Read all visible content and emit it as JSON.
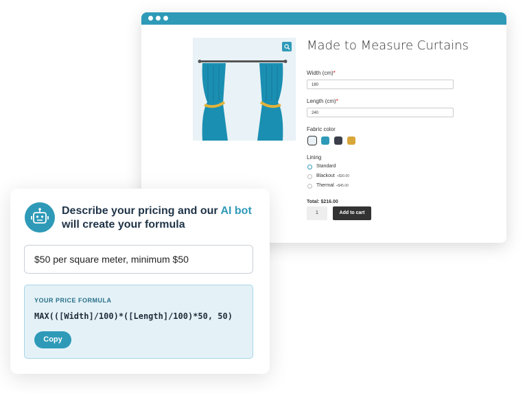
{
  "product": {
    "title": "Made to Measure Curtains",
    "width_label": "Width (cm)",
    "width_value": "180",
    "length_label": "Length (cm)",
    "length_value": "240",
    "required_mark": "*",
    "fabric_label": "Fabric color",
    "fabric_colors": [
      "#e9f2f6",
      "#2e9ab8",
      "#3a3f4a",
      "#d9a63a"
    ],
    "lining_label": "Lining",
    "lining_options": [
      {
        "label": "Standard",
        "price": "",
        "selected": true
      },
      {
        "label": "Blackout",
        "price": "+$30.00",
        "selected": false
      },
      {
        "label": "Thermal",
        "price": "+$45.00",
        "selected": false
      }
    ],
    "total": "Total: $216.00",
    "quantity": "1",
    "add_to_cart": "Add to cart"
  },
  "ai": {
    "headline_a": "Describe your pricing and our ",
    "headline_highlight": "AI bot",
    "headline_b": " will create your formula",
    "prompt": "$50 per square meter, minimum $50",
    "formula_label": "YOUR PRICE FORMULA",
    "formula": "MAX(([Width]/100)*([Length]/100)*50, 50)",
    "copy_label": "Copy"
  },
  "colors": {
    "accent": "#2e9ab8",
    "dark": "#1f3347"
  }
}
